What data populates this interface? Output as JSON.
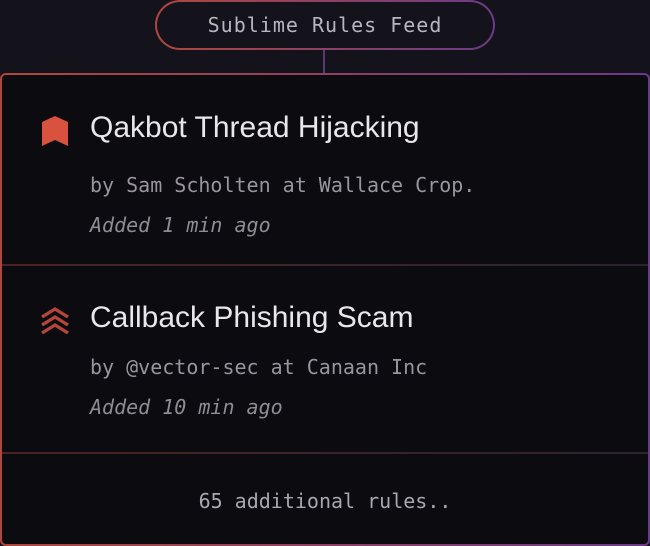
{
  "feed": {
    "title": "Sublime Rules Feed"
  },
  "rules": [
    {
      "title": "Qakbot Thread Hijacking",
      "author_line": "by Sam Scholten at Wallace Crop.",
      "added": "Added 1 min ago",
      "icon": "severity-high-flag-icon",
      "color": "#d9513f"
    },
    {
      "title": "Callback Phishing Scam",
      "author_line": "by @vector-sec at Canaan Inc",
      "added": "Added 10 min ago",
      "icon": "severity-chevrons-up-icon",
      "color": "#b8453a"
    }
  ],
  "footer": {
    "more_label": "65 additional rules.."
  },
  "colors": {
    "background": "#14121a",
    "card": "#0c0b10",
    "accent_red": "#b0473e",
    "accent_purple": "#6b3b88"
  }
}
